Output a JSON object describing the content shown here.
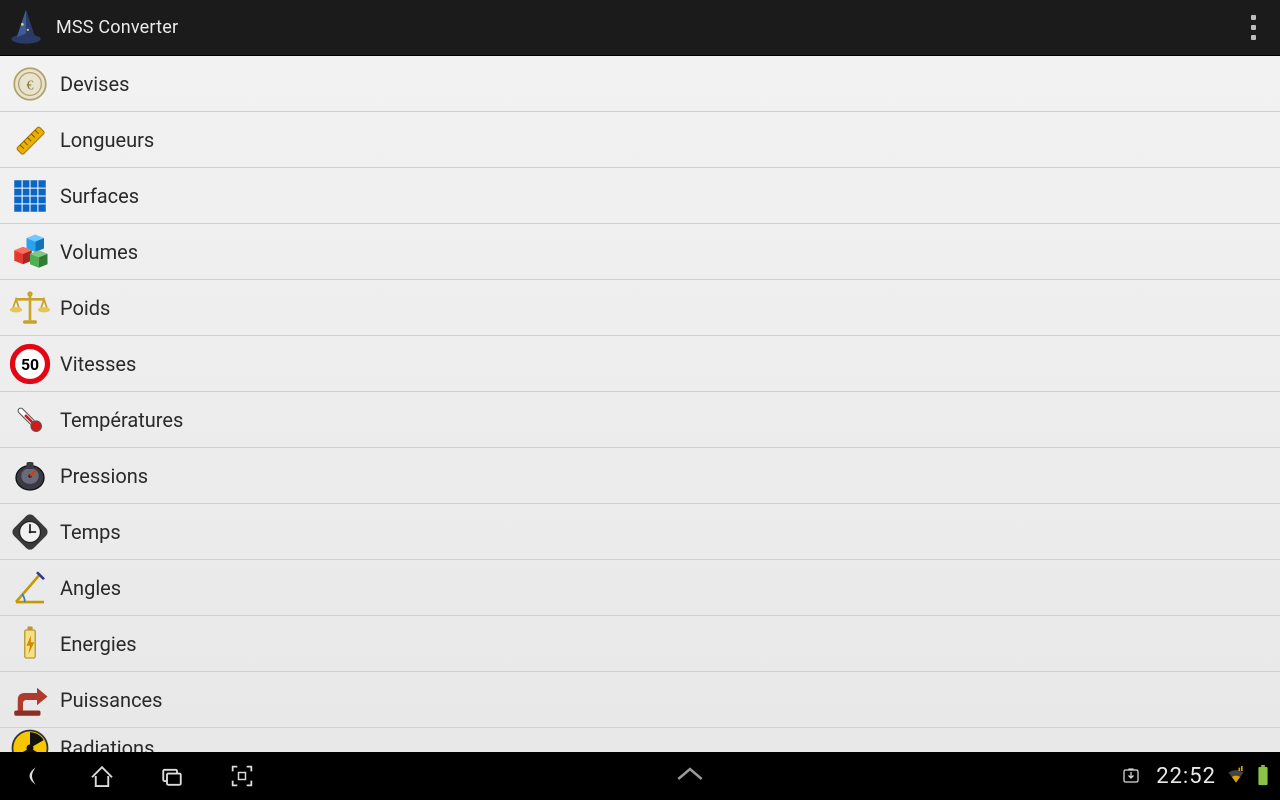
{
  "header": {
    "title": "MSS Converter",
    "app_icon": "wizard-hat-icon",
    "overflow_icon": "overflow-menu-icon"
  },
  "list": {
    "items": [
      {
        "icon": "coin-icon",
        "label": "Devises"
      },
      {
        "icon": "ruler-icon",
        "label": "Longueurs"
      },
      {
        "icon": "grid-icon",
        "label": "Surfaces"
      },
      {
        "icon": "cubes-icon",
        "label": "Volumes"
      },
      {
        "icon": "scale-icon",
        "label": "Poids"
      },
      {
        "icon": "speed-sign-icon",
        "label": "Vitesses",
        "sign_text": "50"
      },
      {
        "icon": "thermometer-icon",
        "label": "Températures"
      },
      {
        "icon": "gauge-icon",
        "label": "Pressions"
      },
      {
        "icon": "clock-icon",
        "label": "Temps"
      },
      {
        "icon": "angle-icon",
        "label": "Angles"
      },
      {
        "icon": "battery-icon",
        "label": "Energies"
      },
      {
        "icon": "power-icon",
        "label": "Puissances"
      },
      {
        "icon": "radiation-icon",
        "label": "Radiations"
      }
    ]
  },
  "navbar": {
    "back_icon": "back-icon",
    "home_icon": "home-icon",
    "recent_icon": "recent-apps-icon",
    "screenshot_icon": "screenshot-icon",
    "expand_icon": "expand-up-icon",
    "download_icon": "download-icon",
    "clock": "22:52",
    "signal_icon": "wifi-speed-icon",
    "battery_icon": "battery-status-icon",
    "battery_color": "#8bc34a"
  }
}
